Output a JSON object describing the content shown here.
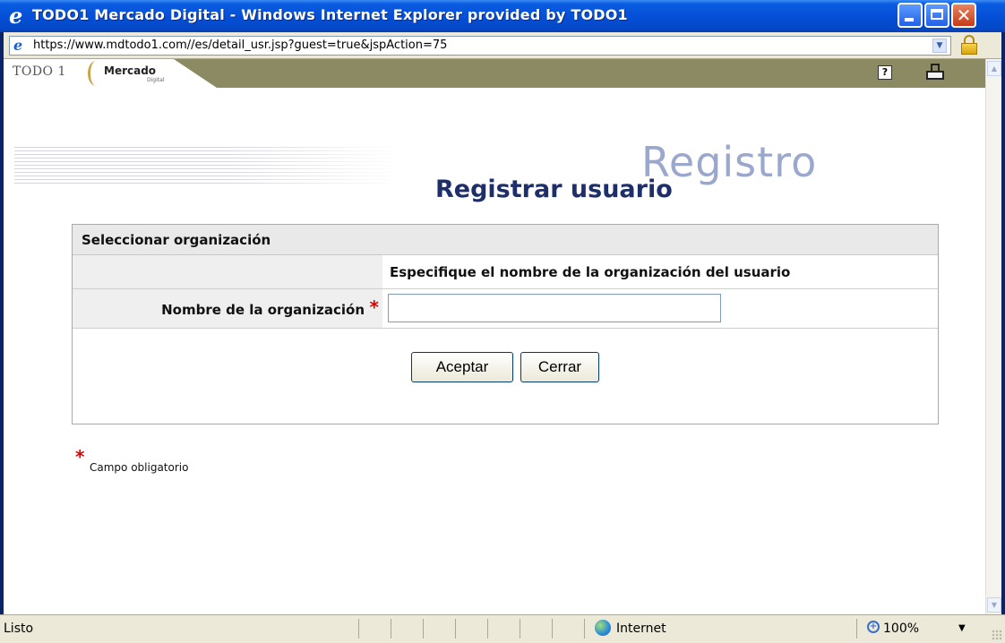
{
  "window": {
    "title": "TODO1 Mercado Digital - Windows Internet Explorer provided by TODO1",
    "icon": "ie-logo-icon",
    "controls": [
      "minimize-icon",
      "maximize-icon",
      "close-icon"
    ]
  },
  "address": {
    "url": "https://www.mdtodo1.com//es/detail_usr.jsp?guest=true&jspAction=75",
    "icons": [
      "page-icon",
      "dropdown-icon",
      "lock-icon"
    ]
  },
  "header": {
    "logo_todo": "TODO 1",
    "logo_mercado": "Mercado",
    "logo_digital": "Digital",
    "icons": [
      "help-icon",
      "print-icon"
    ],
    "bar_color": "#8b8a63"
  },
  "page": {
    "watermark": "Registro",
    "title": "Registrar usuario"
  },
  "form": {
    "section_title": "Seleccionar organización",
    "instructions": "Especifique el nombre de la organización del usuario",
    "field_label": "Nombre de la organización",
    "required_mark": "*",
    "field_value": "",
    "buttons": {
      "accept": "Aceptar",
      "close": "Cerrar"
    }
  },
  "note": {
    "mark": "*",
    "text": "Campo obligatorio"
  },
  "status": {
    "text": "Listo",
    "zone": "Internet",
    "zoom": "100%"
  },
  "colors": {
    "title_color": "#1d2e6b",
    "watermark_color": "#9ba8cd",
    "required_color": "#e00000"
  }
}
